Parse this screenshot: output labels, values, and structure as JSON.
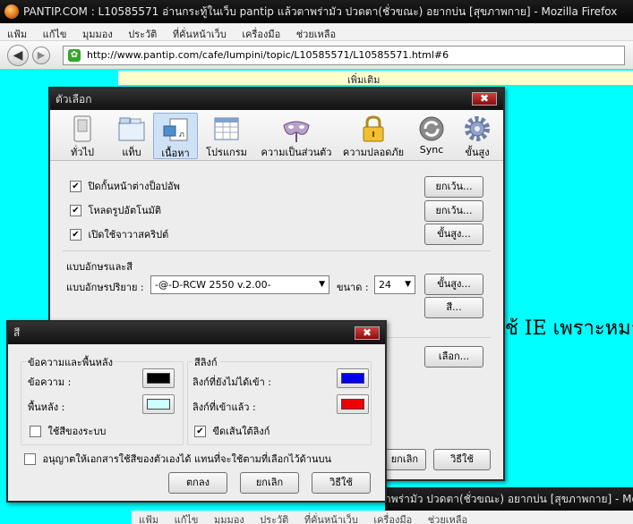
{
  "firefox": {
    "window_title": "PANTIP.COM : L10585571 อ่านกระทู้ในเว็บ pantip แล้วตาพร่ามัว ปวดตา(ชั่วขณะ) อยากบ่น [สุขภาพกาย] - Mozilla Firefox",
    "menu": [
      "แฟ้ม",
      "แก้ไข",
      "มุมมอง",
      "ประวัติ",
      "ที่คั่นหน้าเว็บ",
      "เครื่องมือ",
      "ช่วยเหลือ"
    ],
    "back_glyph": "◀",
    "forward_glyph": "▶",
    "favicon_glyph": "✿",
    "url": "http://www.pantip.com/cafe/lumpini/topic/L10585571/L10585571.html#6"
  },
  "page": {
    "top_text": "เพิ่มเติม",
    "body_text": "ช้ IE เพราะหมา"
  },
  "second_window": {
    "title": "าพร่ามัว ปวดตา(ชั่วขณะ) อยากบ่น [สุขภาพกาย] - Mozilla Firefox",
    "menu": [
      "แฟ้ม",
      "แก้ไข",
      "มุมมอง",
      "ประวัติ",
      "ที่คั่นหน้าเว็บ",
      "เครื่องมือ",
      "ช่วยเหลือ"
    ]
  },
  "options_dialog": {
    "title": "ตัวเลือก",
    "close_glyph": "✖",
    "tabs": [
      {
        "label": "ทั่วไป",
        "icon": "switch-icon"
      },
      {
        "label": "แท็บ",
        "icon": "tabs-icon"
      },
      {
        "label": "เนื้อหา",
        "icon": "content-icon",
        "selected": true
      },
      {
        "label": "โปรแกรม",
        "icon": "applications-icon"
      },
      {
        "label": "ความเป็นส่วนตัว",
        "icon": "privacy-mask-icon"
      },
      {
        "label": "ความปลอดภัย",
        "icon": "padlock-icon"
      },
      {
        "label": "Sync",
        "icon": "sync-icon"
      },
      {
        "label": "ขั้นสูง",
        "icon": "gear-icon"
      }
    ],
    "checkboxes": [
      {
        "label": "ปิดกั้นหน้าต่างป็อปอัพ",
        "checked": true,
        "button": "ยกเว้น..."
      },
      {
        "label": "โหลดรูปอัตโนมัติ",
        "checked": true,
        "button": "ยกเว้น..."
      },
      {
        "label": "เปิดใช้จาวาสคริปต์",
        "checked": true,
        "button": "ขั้นสูง..."
      }
    ],
    "check_glyph": "✔",
    "fonts_section": "แบบอักษรและสี",
    "default_font_label": "แบบอักษรปริยาย :",
    "default_font_value": "-@-D-RCW 2550 v.2.00-",
    "size_label": "ขนาด :",
    "size_value": "24",
    "dropdown_glyph": "▼",
    "fonts_advanced_button": "ขั้นสูง...",
    "colors_button": "สี...",
    "languages_button": "เลือก...",
    "cancel_button": "ยกเลิก",
    "help_button": "วิธีใช้"
  },
  "colors_dialog": {
    "title": "สี",
    "close_glyph": "✖",
    "text_bg_group": "ข้อความและพื้นหลัง",
    "text_label": "ข้อความ :",
    "background_label": "พื้นหลัง :",
    "use_system_colors": "ใช้สีของระบบ",
    "links_group": "สีลิงก์",
    "unvisited_label": "ลิงก์ที่ยังไม่ได้เข้า :",
    "visited_label": "ลิงก์ที่เข้าแล้ว :",
    "underline_links": "ขีดเส้นใต้ลิงก์",
    "allow_page_colors": "อนุญาตให้เอกสารใช้สีของตัวเองได้ แทนที่จะใช้ตามที่เลือกไว้ด้านบน",
    "ok_button": "ตกลง",
    "cancel_button": "ยกเลิก",
    "help_button": "วิธีใช้",
    "colors": {
      "text": "#000000",
      "background": "#ccffff",
      "unvisited": "#0000ee",
      "visited": "#ee0000"
    },
    "use_system_colors_checked": false,
    "underline_links_checked": true,
    "allow_page_colors_checked": false
  }
}
